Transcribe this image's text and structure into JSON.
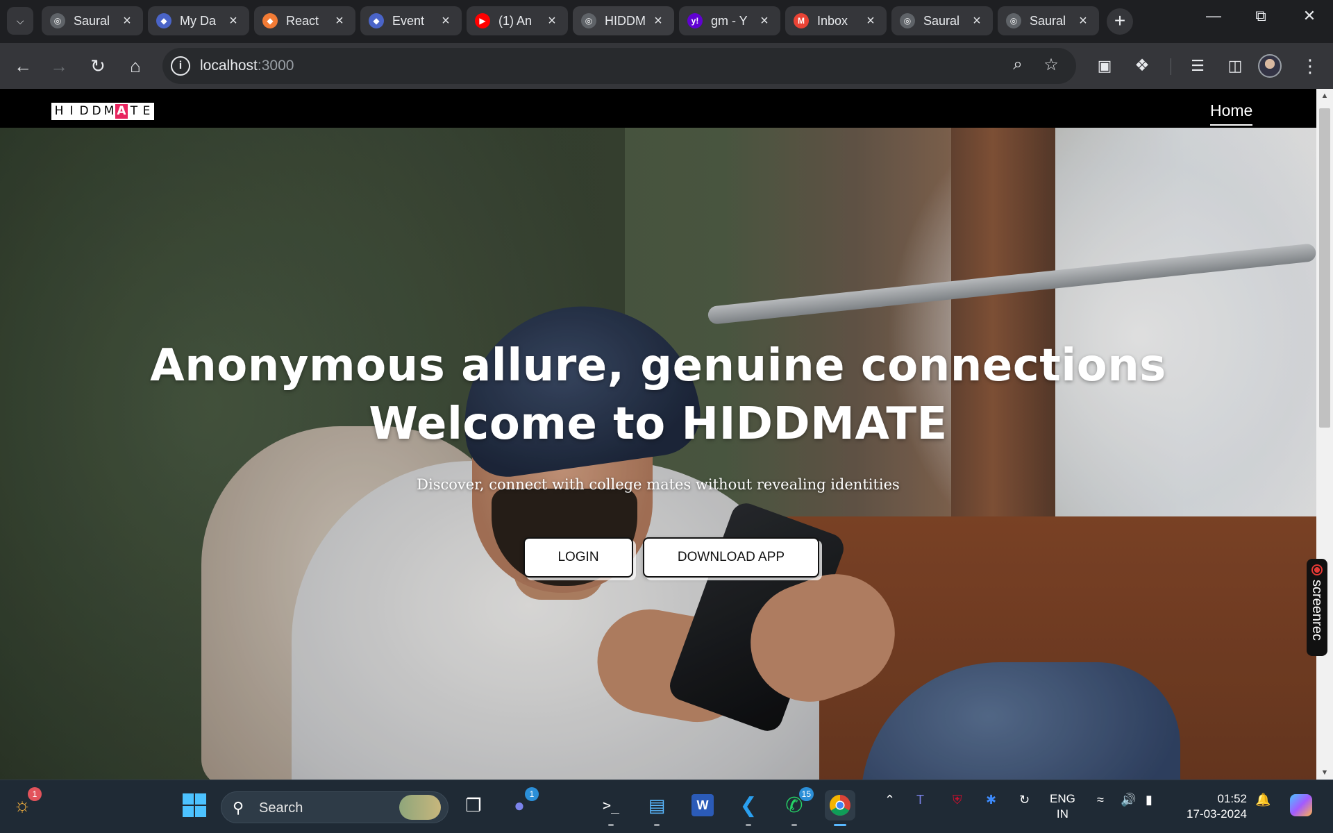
{
  "browser": {
    "tabs": [
      {
        "title": "Saural",
        "favicon": "globe-icon",
        "color": "#5f6368"
      },
      {
        "title": "My Da",
        "favicon": "feather-icon",
        "color": "#4a64c8"
      },
      {
        "title": "React",
        "favicon": "shield-icon",
        "color": "#f27b35"
      },
      {
        "title": "Event",
        "favicon": "feather-icon",
        "color": "#4a64c8"
      },
      {
        "title": "(1) An",
        "favicon": "youtube-icon",
        "color": "#ff0000"
      },
      {
        "title": "HIDDM",
        "favicon": "globe-icon",
        "color": "#5f6368",
        "active": true
      },
      {
        "title": "gm - Y",
        "favicon": "yahoo-icon",
        "color": "#6001d2"
      },
      {
        "title": "Inbox",
        "favicon": "gmail-icon",
        "color": "#ea4335"
      },
      {
        "title": "Saural",
        "favicon": "globe-icon",
        "color": "#5f6368"
      },
      {
        "title": "Saural",
        "favicon": "globe-icon",
        "color": "#5f6368"
      }
    ],
    "url_host": "localhost",
    "url_port": ":3000"
  },
  "site": {
    "logo_letters": [
      "H",
      "I",
      "D",
      "D",
      "M",
      "A",
      "T",
      "E"
    ],
    "logo_highlight_letter": "A",
    "nav_home": "Home",
    "accent_color": "#e8245e"
  },
  "hero": {
    "title_line1": "Anonymous allure, genuine connections",
    "title_line2": "Welcome to HIDDMATE",
    "subtitle": "Discover, connect with college mates without revealing identities",
    "login_label": "LOGIN",
    "download_label": "DOWNLOAD APP"
  },
  "overlay": {
    "screenrec_label": "screenrec"
  },
  "taskbar": {
    "search_placeholder": "Search",
    "weather_badge": "1",
    "teams_badge": "1",
    "whatsapp_badge": "15",
    "lang_line1": "ENG",
    "lang_line2": "IN",
    "time": "01:52",
    "date": "17-03-2024"
  }
}
